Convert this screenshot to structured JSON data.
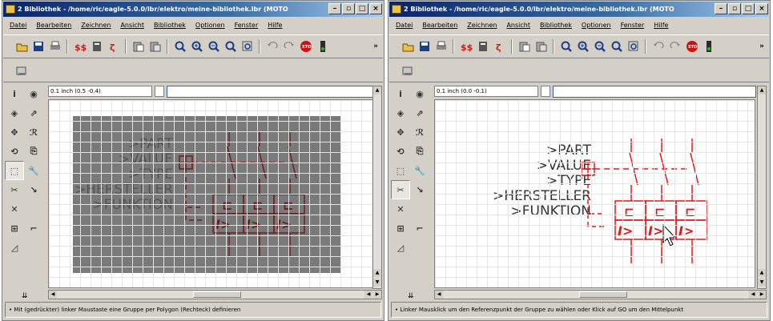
{
  "windows": [
    {
      "id": "left",
      "title": "2 Bibliothek - /home/ric/eagle-5.0.0/lbr/elektro/meine-bibliothek.lbr (MOTO",
      "coordinate": "0.1 inch (0.5 -0.4)",
      "status": "Mit (gedrückter) linker Maustaste eine Gruppe per Polygon (Rechteck) definieren",
      "group_selected": true,
      "symbol_color": "#6b1f1f",
      "selection_color": "#7a7a7a"
    },
    {
      "id": "right",
      "title": "2 Bibliothek - /home/ric/eagle-5.0.0/lbr/elektro/meine-bibliothek.lbr (MOTO",
      "coordinate": "0.1 inch (0.0 -0.1)",
      "status": "Linker Mausklick um den Referenzpunkt der Gruppe zu wählen oder Klick auf GO um den Mittelpunkt",
      "group_selected": false,
      "symbol_color": "#e01818",
      "selection_color": ""
    }
  ],
  "menu": [
    "Datei",
    "Bearbeiten",
    "Zeichnen",
    "Ansicht",
    "Bibliothek",
    "Optionen",
    "Fenster",
    "Hilfe"
  ],
  "toolbar_more": "»",
  "symbol_labels": [
    ">PART",
    ">VALUE",
    ">TYPE",
    ">HERSTELLER",
    ">FUNKTION"
  ],
  "symbol_box_top": [
    "⊏",
    "⊏",
    "⊏"
  ],
  "symbol_box_bottom": [
    "I>",
    "I>",
    "I>"
  ],
  "window_buttons": [
    "–",
    "▫",
    "□",
    "×"
  ]
}
